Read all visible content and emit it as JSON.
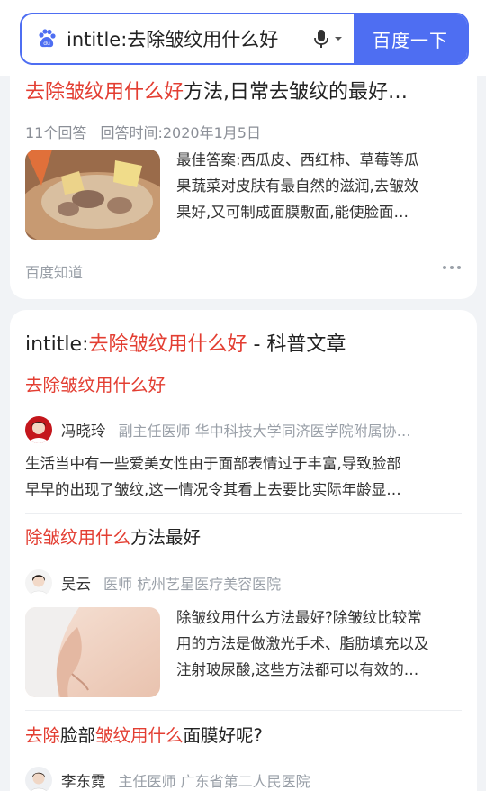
{
  "search": {
    "query": "intitle:去除皱纹用什么好",
    "button_label": "百度一下"
  },
  "result1": {
    "title_highlight": "去除皱纹用什么好",
    "title_rest": "方法,日常去皱纹的最好…",
    "answers": "11个回答",
    "time_label": "回答时间:",
    "time_value": "2020年1月5日",
    "snippet_line1": "最佳答案:西瓜皮、西红柿、草莓等瓜",
    "snippet_line2": "果蔬菜对皮肤有最自然的滋润,去皱效",
    "snippet_line3": "果好,又可制成面膜敷面,能使脸面…",
    "source": "百度知道"
  },
  "result2": {
    "title_prefix": "intitle:",
    "title_highlight": "去除皱纹用什么好",
    "title_rest": " - 科普文章",
    "sections": [
      {
        "heading_highlight": "去除皱纹用什么好",
        "heading_rest": "",
        "author": "冯晓玲",
        "author_title": "副主任医师 华中科技大学同济医学院附属协…",
        "text_line1": "生活当中有一些爱美女性由于面部表情过于丰富,导致脸部",
        "text_line2": "早早的出现了皱纹,这一情况令其看上去要比实际年龄显…"
      },
      {
        "heading_highlight": "除皱纹用什么",
        "heading_rest": "方法最好",
        "author": "吴云",
        "author_title": "医师 杭州艺星医疗美容医院",
        "text_line1": "除皱纹用什么方法最好?除皱纹比较常",
        "text_line2": "用的方法是做激光手术、脂肪填充以及",
        "text_line3": "注射玻尿酸,这些方法都可以有效的…"
      },
      {
        "heading_highlight1": "去除",
        "heading_mid": "脸部",
        "heading_highlight2": "皱纹用什么",
        "heading_rest": "面膜好呢?",
        "author": "李东霓",
        "author_title": "主任医师 广东省第二人民医院"
      }
    ]
  },
  "colors": {
    "brand": "#4e6ef2",
    "highlight": "#e33e32",
    "muted": "#8b8f97"
  }
}
